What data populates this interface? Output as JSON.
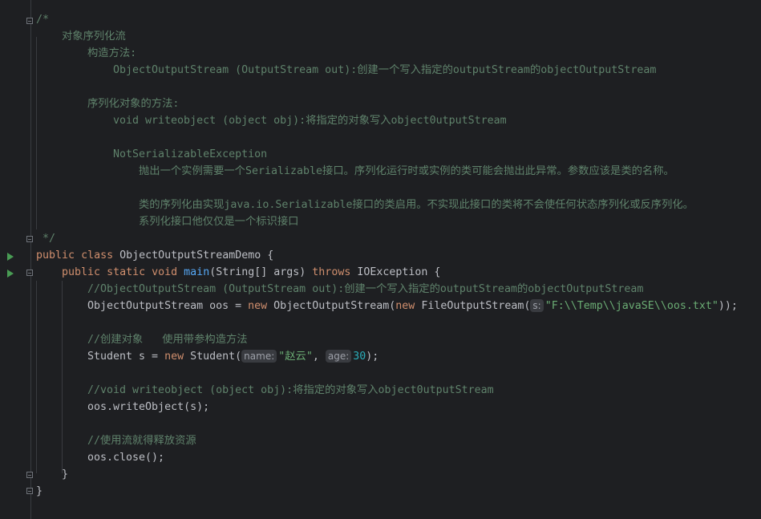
{
  "comment_block": {
    "open": "/*",
    "l1": "对象序列化流",
    "l2": "构造方法:",
    "l3": "ObjectOutputStream (OutputStream out):创建一个写入指定的outputStream的objectOutputStream",
    "l4": "序列化对象的方法:",
    "l5": "void writeobject (object obj):将指定的对象写入object0utputStream",
    "l6": "NotSerializableException",
    "l7": "抛出一个实例需要一个Serializable接口。序列化运行时或实例的类可能会抛出此异常。参数应该是类的名称。",
    "l8": "类的序列化由实现java.io.Serializable接口的类启用。不实现此接口的类将不会使任何状态序列化或反序列化。",
    "l9": "系列化接口他仅仅是一个标识接口",
    "close": " */"
  },
  "code": {
    "class_kw1": "public",
    "class_kw2": "class",
    "class_name": "ObjectOutputStreamDemo {",
    "main_kw1": "public",
    "main_kw2": "static",
    "main_kw3": "void",
    "main_fn": "main",
    "main_params": "(String[] args) ",
    "main_throws": "throws",
    "main_exc": " IOException {",
    "c1": "//ObjectOutputStream (OutputStream out):创建一个写入指定的outputStream的objectOutputStream",
    "l_oos_a": "ObjectOutputStream oos = ",
    "l_oos_new1": "new",
    "l_oos_b": " ObjectOutputStream(",
    "l_oos_new2": "new",
    "l_oos_c": " FileOutputStream(",
    "hint_s": "s:",
    "l_oos_str": "\"F:\\\\Temp\\\\javaSE\\\\oos.txt\"",
    "l_oos_end": "));",
    "c2": "//创建对象   使用带参构造方法",
    "l_stu_a": "Student s = ",
    "l_stu_new": "new",
    "l_stu_b": " Student(",
    "hint_name": "name:",
    "l_stu_str": "\"赵云\"",
    "l_stu_comma": ", ",
    "hint_age": "age:",
    "l_stu_num": "30",
    "l_stu_end": ");",
    "c3": "//void writeobject (object obj):将指定的对象写入object0utputStream",
    "l_write": "oos.writeObject(s);",
    "c4": "//使用流就得释放资源",
    "l_close": "oos.close();",
    "brace1": "}",
    "brace2": "}"
  }
}
